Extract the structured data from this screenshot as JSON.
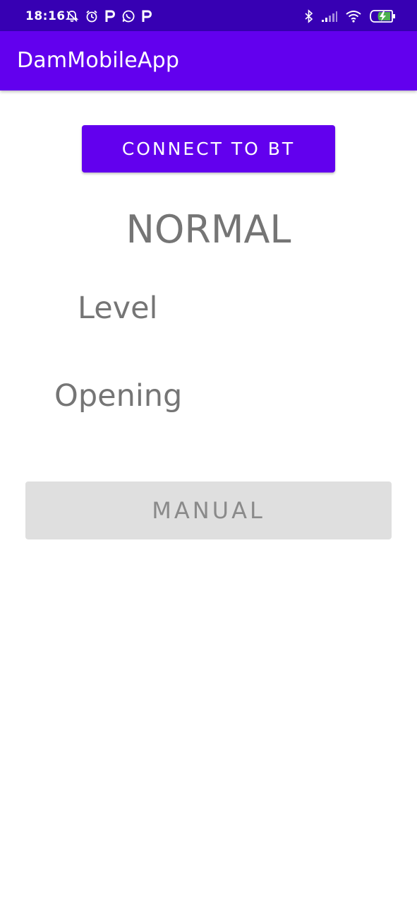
{
  "status_bar": {
    "time": "18:16",
    "left_icons": [
      "alarm-off-icon",
      "alarm-clock-icon",
      "parking-p-icon",
      "whatsapp-icon",
      "parking-p-icon"
    ],
    "right_icons": [
      "bluetooth-icon",
      "cell-signal-icon",
      "wifi-icon",
      "battery-charging-icon"
    ],
    "background_color": "#3700b3"
  },
  "app_bar": {
    "title": "DamMobileApp",
    "background_color": "#6200ee"
  },
  "main": {
    "connect_button_label": "CONNECT TO BT",
    "state_text": "NORMAL",
    "level_label": "Level",
    "opening_label": "Opening",
    "manual_button_label": "MANUAL"
  },
  "colors": {
    "primary": "#6200ee",
    "primary_dark": "#3700b3",
    "text_secondary": "#757575",
    "disabled_button": "#dfdfdf"
  }
}
